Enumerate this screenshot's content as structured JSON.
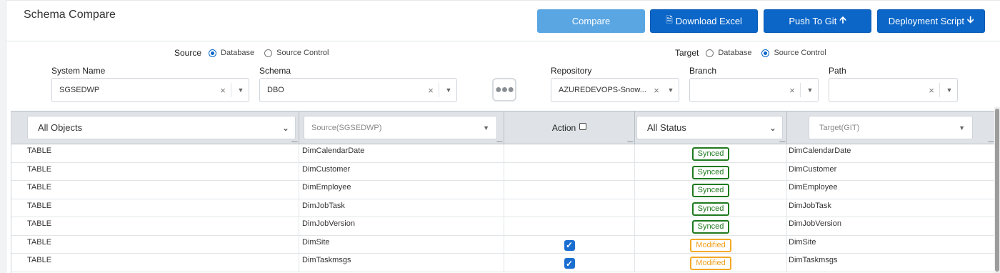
{
  "header": {
    "title": "Schema Compare",
    "buttons": {
      "compare": "Compare",
      "download": "Download Excel",
      "push": "Push To Git",
      "deploy": "Deployment Script"
    }
  },
  "source": {
    "label": "Source",
    "options": [
      "Database",
      "Source Control"
    ],
    "selected": "Database",
    "system_name_label": "System Name",
    "system_name_value": "SGSEDWP",
    "schema_label": "Schema",
    "schema_value": "DBO"
  },
  "target": {
    "label": "Target",
    "options": [
      "Database",
      "Source Control"
    ],
    "selected": "Source Control",
    "repository_label": "Repository",
    "repository_value": "AZUREDEVOPS-Snow...",
    "branch_label": "Branch",
    "branch_value": "",
    "path_label": "Path",
    "path_value": ""
  },
  "grid": {
    "filter_objects": "All Objects",
    "filter_source_placeholder": "Source(SGSEDWP)",
    "action_label": "Action",
    "filter_status": "All Status",
    "filter_target_placeholder": "Target(GIT)",
    "rows": [
      {
        "type": "TABLE",
        "source": "DimCalendarDate",
        "checked": false,
        "status": "Synced",
        "target": "DimCalendarDate"
      },
      {
        "type": "TABLE",
        "source": "DimCustomer",
        "checked": false,
        "status": "Synced",
        "target": "DimCustomer"
      },
      {
        "type": "TABLE",
        "source": "DimEmployee",
        "checked": false,
        "status": "Synced",
        "target": "DimEmployee"
      },
      {
        "type": "TABLE",
        "source": "DimJobTask",
        "checked": false,
        "status": "Synced",
        "target": "DimJobTask"
      },
      {
        "type": "TABLE",
        "source": "DimJobVersion",
        "checked": false,
        "status": "Synced",
        "target": "DimJobVersion"
      },
      {
        "type": "TABLE",
        "source": "DimSite",
        "checked": true,
        "status": "Modified",
        "target": "DimSite"
      },
      {
        "type": "TABLE",
        "source": "DimTaskmsgs",
        "checked": true,
        "status": "Modified",
        "target": "DimTaskmsgs"
      }
    ]
  },
  "colors": {
    "primary": "#0b66c8",
    "primary_light": "#5aa6e3",
    "synced": "#1f7a1f",
    "modified": "#f0a01c"
  }
}
